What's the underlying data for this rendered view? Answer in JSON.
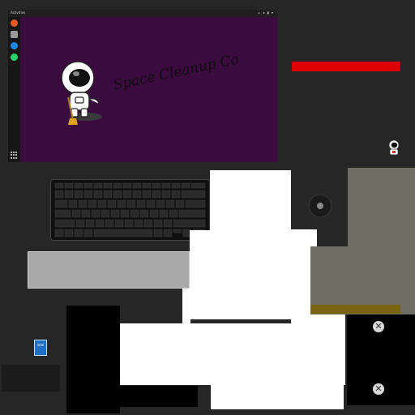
{
  "topbar": {
    "activities_label": "Activities",
    "tray_icons": "⌂ ◂ ▮ ▾"
  },
  "dock": {
    "items": [
      {
        "name": "firefox-icon",
        "color": "#e8571f"
      },
      {
        "name": "camera-icon",
        "color": "#9a9a9a"
      },
      {
        "name": "phone-icon",
        "color": "#1e88e5"
      },
      {
        "name": "whatsapp-icon",
        "color": "#25d366"
      }
    ]
  },
  "wallpaper": {
    "title": "Space Cleanup Co",
    "bg_color": "#3b0a3f"
  },
  "colors": {
    "red_bar": "#e00000",
    "olive_panel": "#6e6d62",
    "olive_bar": "#7a6410",
    "intel_blue": "#1f6fc4"
  },
  "intel_badge": {
    "label": "intel"
  }
}
